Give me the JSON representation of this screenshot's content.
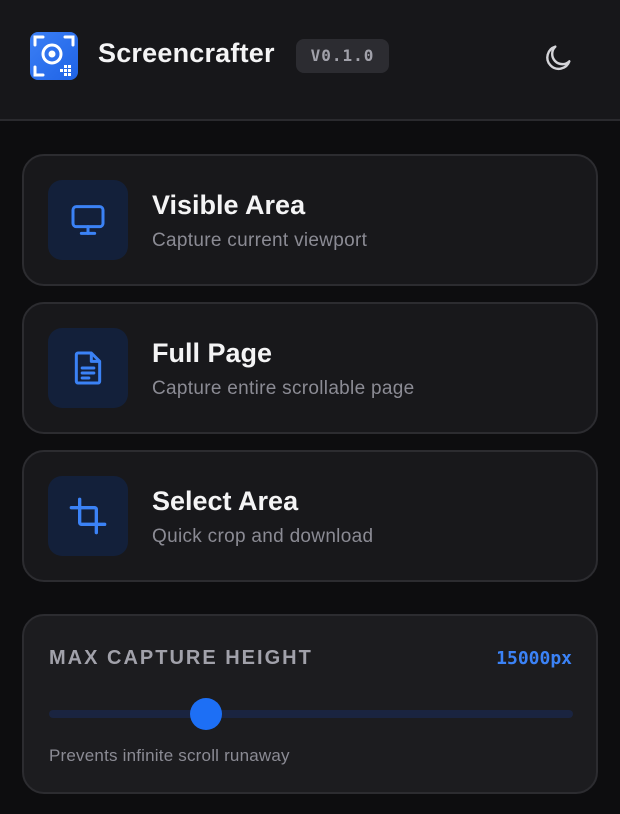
{
  "header": {
    "title": "Screencrafter",
    "version": "V0.1.0",
    "logo_icon": "screencrafter-logo-icon",
    "theme_icon": "moon-icon"
  },
  "capture_options": [
    {
      "id": "visible",
      "title": "Visible Area",
      "subtitle": "Capture current viewport",
      "icon": "monitor-icon"
    },
    {
      "id": "full",
      "title": "Full Page",
      "subtitle": "Capture entire scrollable page",
      "icon": "document-icon"
    },
    {
      "id": "select",
      "title": "Select Area",
      "subtitle": "Quick crop and download",
      "icon": "crop-icon"
    }
  ],
  "max_height": {
    "label": "MAX CAPTURE HEIGHT",
    "value_label": "15000px",
    "slider_fraction": 0.3,
    "hint": "Prevents infinite scroll runaway"
  },
  "colors": {
    "accent": "#3b82f6",
    "background": "#0d0d0f",
    "card": "#18181b",
    "icon_bg": "#13203a"
  }
}
